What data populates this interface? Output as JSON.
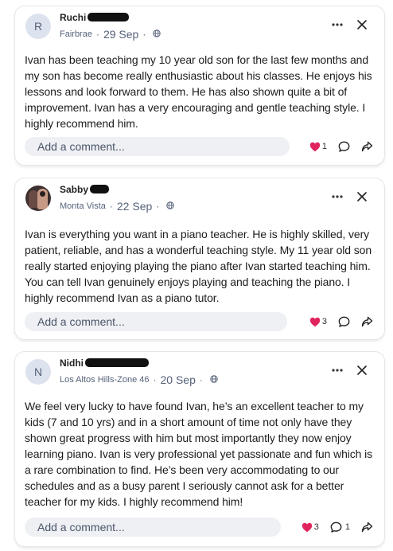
{
  "posts": [
    {
      "author": "Ruchi",
      "avatar_initial": "R",
      "location": "Fairbrae",
      "date": "29 Sep",
      "text": "Ivan has been teaching my 10 year old son for the last few months and my son has become really enthusiastic about his classes. He enjoys his lessons and look forward to them. He has also shown quite a bit of improvement. Ivan has a very encouraging and gentle teaching style. I highly recommend him.",
      "comment_placeholder": "Add a comment...",
      "reaction_count": "1",
      "comment_count": ""
    },
    {
      "author": "Sabby",
      "avatar_initial": "",
      "location": "Monta Vista",
      "date": "22 Sep",
      "text": "Ivan is everything you want in a piano teacher. He is highly skilled, very patient, reliable, and has a wonderful teaching style. My 11 year old son really started enjoying playing the piano after Ivan started teaching him. You can tell Ivan genuinely enjoys playing and teaching the piano. I highly recommend Ivan as a piano tutor.",
      "comment_placeholder": "Add a comment...",
      "reaction_count": "3",
      "comment_count": ""
    },
    {
      "author": "Nidhi",
      "avatar_initial": "N",
      "location": "Los Altos Hills-Zone 46",
      "date": "20 Sep",
      "text": "We feel very lucky to have found Ivan, he’s an excellent teacher to my kids (7 and 10 yrs) and in a short amount of time not only have they shown great progress with him but most importantly they now enjoy learning piano. Ivan is very professional yet passionate and fun which is a rare combination to find. He’s been very accommodating to our schedules and as a busy parent I seriously cannot ask for a better teacher for my kids. I highly recommend him!",
      "comment_placeholder": "Add a comment...",
      "reaction_count": "3",
      "comment_count": "1"
    }
  ],
  "separator": "·",
  "icons": {
    "more": "more-horizontal-icon",
    "close": "close-icon",
    "globe": "globe-icon",
    "heart": "heart-icon",
    "comment": "comment-bubble-icon",
    "share": "share-icon"
  },
  "colors": {
    "heart": "#e0245e",
    "meta_text": "#55627a",
    "comment_bg": "#eef0f4"
  }
}
